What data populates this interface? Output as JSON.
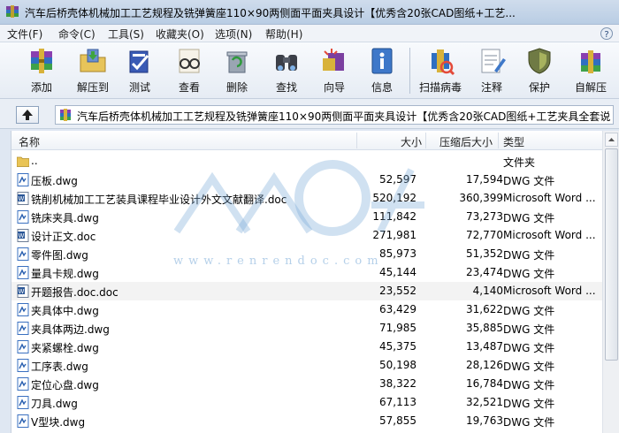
{
  "window": {
    "title": "汽车后桥壳体机械加工工艺规程及铣弹簧座110×90两侧面平面夹具设计【优秀含20张CAD图纸+工艺..."
  },
  "menu": {
    "items": [
      "文件(F)",
      "命令(C)",
      "工具(S)",
      "收藏夹(O)",
      "选项(N)",
      "帮助(H)"
    ]
  },
  "toolbar": {
    "add": "添加",
    "extract": "解压到",
    "test": "测试",
    "view": "查看",
    "delete": "删除",
    "find": "查找",
    "wizard": "向导",
    "info": "信息",
    "scan": "扫描病毒",
    "comment": "注释",
    "protect": "保护",
    "sfx": "自解压"
  },
  "address": {
    "path": "汽车后桥壳体机械加工工艺规程及铣弹簧座110×90两侧面平面夹具设计【优秀含20张CAD图纸+工艺夹具全套说"
  },
  "columns": {
    "name": "名称",
    "size": "大小",
    "packed": "压缩后大小",
    "type": "类型"
  },
  "files": [
    {
      "name": "..",
      "size": "",
      "packed": "",
      "type": "文件夹",
      "icon": "folder-icon"
    },
    {
      "name": "压板.dwg",
      "size": "52,597",
      "packed": "17,594",
      "type": "DWG 文件",
      "icon": "dwg-file-icon"
    },
    {
      "name": "铣削机械加工工艺装具课程毕业设计外文文献翻译.doc",
      "size": "520,192",
      "packed": "360,399",
      "type": "Microsoft Word ...",
      "icon": "word-file-icon"
    },
    {
      "name": "铣床夹具.dwg",
      "size": "111,842",
      "packed": "73,273",
      "type": "DWG 文件",
      "icon": "dwg-file-icon"
    },
    {
      "name": "设计正文.doc",
      "size": "271,981",
      "packed": "72,770",
      "type": "Microsoft Word ...",
      "icon": "word-file-icon"
    },
    {
      "name": "零件图.dwg",
      "size": "85,973",
      "packed": "51,352",
      "type": "DWG 文件",
      "icon": "dwg-file-icon"
    },
    {
      "name": "量具卡规.dwg",
      "size": "45,144",
      "packed": "23,474",
      "type": "DWG 文件",
      "icon": "dwg-file-icon"
    },
    {
      "name": "开题报告.doc.doc",
      "size": "23,552",
      "packed": "4,140",
      "type": "Microsoft Word ...",
      "icon": "word-file-icon"
    },
    {
      "name": "夹具体中.dwg",
      "size": "63,429",
      "packed": "31,622",
      "type": "DWG 文件",
      "icon": "dwg-file-icon"
    },
    {
      "name": "夹具体两边.dwg",
      "size": "71,985",
      "packed": "35,885",
      "type": "DWG 文件",
      "icon": "dwg-file-icon"
    },
    {
      "name": "夹紧螺栓.dwg",
      "size": "45,375",
      "packed": "13,487",
      "type": "DWG 文件",
      "icon": "dwg-file-icon"
    },
    {
      "name": "工序表.dwg",
      "size": "50,198",
      "packed": "28,126",
      "type": "DWG 文件",
      "icon": "dwg-file-icon"
    },
    {
      "name": "定位心盘.dwg",
      "size": "38,322",
      "packed": "16,784",
      "type": "DWG 文件",
      "icon": "dwg-file-icon"
    },
    {
      "name": "刀具.dwg",
      "size": "67,113",
      "packed": "32,521",
      "type": "DWG 文件",
      "icon": "dwg-file-icon"
    },
    {
      "name": "V型块.dwg",
      "size": "57,855",
      "packed": "19,763",
      "type": "DWG 文件",
      "icon": "dwg-file-icon"
    }
  ],
  "watermark": {
    "text": "www.renrendoc.com"
  },
  "colors": {
    "selected_row": "#f3f3f3",
    "watermark": "#78aad7"
  }
}
